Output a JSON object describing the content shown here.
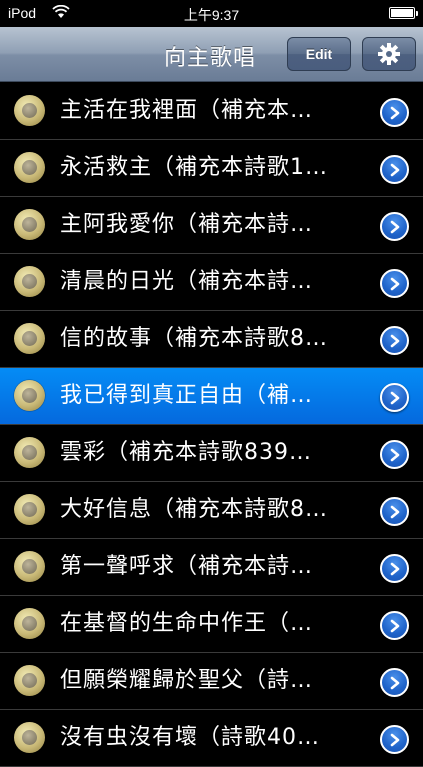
{
  "status_bar": {
    "carrier": "iPod",
    "time": "上午9:37"
  },
  "nav": {
    "title": "向主歌唱",
    "edit_label": "Edit"
  },
  "songs": [
    {
      "title": "主活在我裡面（補充本…"
    },
    {
      "title": "永活救主（補充本詩歌1…"
    },
    {
      "title": "主阿我愛你（補充本詩…"
    },
    {
      "title": "清晨的日光（補充本詩…"
    },
    {
      "title": "信的故事（補充本詩歌8…"
    },
    {
      "title": "我已得到真正自由（補…",
      "selected": true
    },
    {
      "title": "雲彩（補充本詩歌839…"
    },
    {
      "title": "大好信息（補充本詩歌8…"
    },
    {
      "title": "第一聲呼求（補充本詩…"
    },
    {
      "title": "在基督的生命中作王（…"
    },
    {
      "title": "但願榮耀歸於聖父（詩…"
    },
    {
      "title": "沒有虫沒有壞（詩歌40…"
    }
  ],
  "colors": {
    "selected_row": "#0576e8",
    "nav_bar": "#8595ab",
    "disclosure": "#2a6fd6"
  }
}
